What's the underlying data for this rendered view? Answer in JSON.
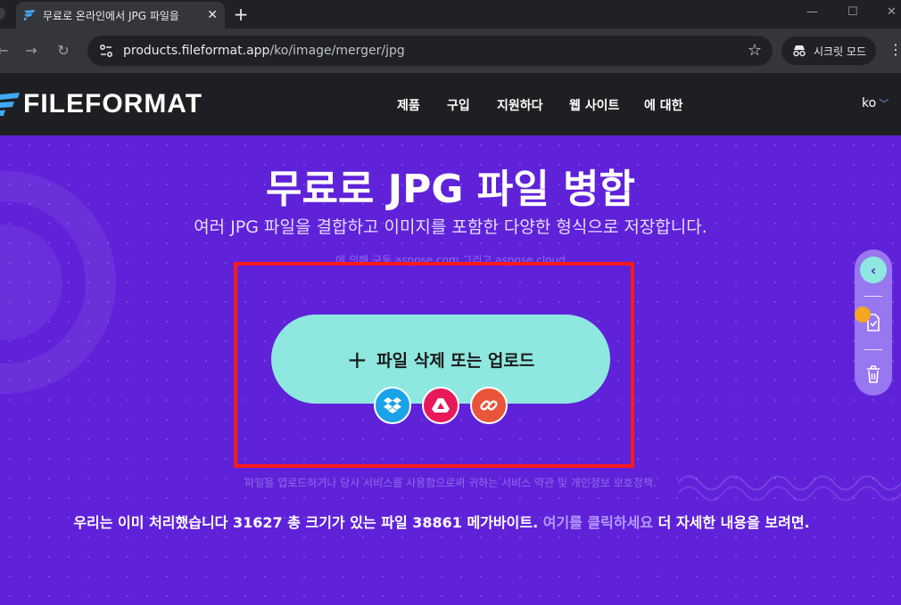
{
  "browser": {
    "tab_title": "무료로 온라인에서 JPG 파일을",
    "tab_close": "✕",
    "new_tab": "+",
    "url_host": "products.fileformat.app",
    "url_path": "/ko/image/merger/jpg",
    "incognito_label": "시크릿 모드",
    "window_minimize": "—",
    "window_maximize": "☐",
    "window_close": "✕"
  },
  "site": {
    "logo_text": "FILEFORMAT",
    "nav": [
      "제품",
      "구입",
      "지원하다",
      "웹 사이트",
      "에 대한"
    ],
    "lang": "ko"
  },
  "hero": {
    "title": "무료로 JPG 파일 병합",
    "subtitle": "여러 JPG 파일을 결합하고 이미지를 포함한 다양한 형식으로 저장합니다.",
    "powered_by": "에 의해 구동 aspose.com 그리고 aspose.cloud",
    "upload_label": "파일 삭제 또는 업로드",
    "upload_plus": "+",
    "terms": "파일을 업로드하거나 당사 서비스를 사용함으로써 귀하는 서비스 약관 및 개인정보 보호정책.",
    "stats_prefix": "우리는 이미 처리했습니다 31627 총 크기가 있는 파일 38861 메가바이트.",
    "stats_link": "여기를 클릭하세요",
    "stats_suffix": "더 자세한 내용을 보려면."
  },
  "side_panel": {
    "back_icon": "‹"
  },
  "colors": {
    "hero_bg": "#5f22d9",
    "accent": "#8ee8e0",
    "highlight": "#ff1a1a"
  }
}
